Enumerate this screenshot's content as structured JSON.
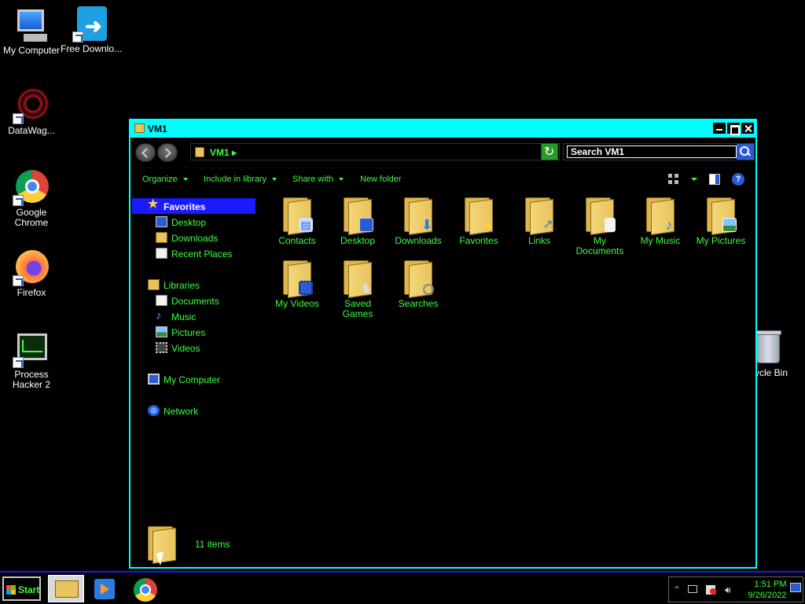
{
  "desktop": {
    "icons": {
      "my_computer": "My Computer",
      "free_download": "Free Downlo...",
      "datawag": "DataWag...",
      "chrome": "Google Chrome",
      "firefox": "Firefox",
      "process_hacker": "Process Hacker 2",
      "recycle_bin": "ycle Bin"
    }
  },
  "window": {
    "title": "VM1",
    "address": {
      "crumb": "VM1 ▸"
    },
    "search": {
      "placeholder": "Search VM1"
    },
    "toolbar": {
      "organize": "Organize",
      "include_in_library": "Include in library",
      "share_with": "Share with",
      "new_folder": "New folder"
    },
    "nav": {
      "favorites": "Favorites",
      "desktop": "Desktop",
      "downloads": "Downloads",
      "recent_places": "Recent Places",
      "libraries": "Libraries",
      "documents": "Documents",
      "music": "Music",
      "pictures": "Pictures",
      "videos": "Videos",
      "my_computer": "My Computer",
      "network": "Network"
    },
    "items": {
      "contacts": "Contacts",
      "desktop": "Desktop",
      "downloads": "Downloads",
      "favorites": "Favorites",
      "links": "Links",
      "my_documents": "My Documents",
      "my_music": "My Music",
      "my_pictures": "My Pictures",
      "my_videos": "My Videos",
      "saved_games": "Saved Games",
      "searches": "Searches"
    },
    "status": {
      "count": "11 items"
    }
  },
  "taskbar": {
    "start": "Start",
    "time": "1:51 PM",
    "date": "9/26/2022"
  },
  "colors": {
    "accent": "#00ffff",
    "text": "#3cff3c",
    "selection": "#1a1aff",
    "background": "#000000"
  }
}
